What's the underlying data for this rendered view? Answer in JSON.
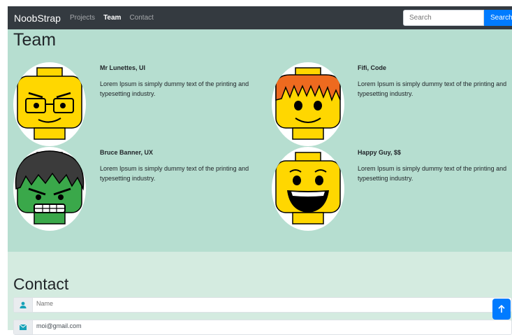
{
  "navbar": {
    "brand": "NoobStrap",
    "links": [
      {
        "label": "Projects",
        "active": false
      },
      {
        "label": "Team",
        "active": true
      },
      {
        "label": "Contact",
        "active": false
      }
    ],
    "search_placeholder": "Search",
    "search_button": "Search"
  },
  "team": {
    "title": "Team",
    "members": [
      {
        "name": "Mr Lunettes, UI",
        "desc": "Lorem Ipsum is simply dummy text of the printing and typesetting industry.",
        "avatar": "glasses-face-icon"
      },
      {
        "name": "Fifi, Code",
        "desc": "Lorem Ipsum is simply dummy text of the printing and typesetting industry.",
        "avatar": "orange-hair-face-icon"
      },
      {
        "name": "Bruce Banner, UX",
        "desc": "Lorem Ipsum is simply dummy text of the printing and typesetting industry.",
        "avatar": "hulk-face-icon"
      },
      {
        "name": "Happy Guy, $$",
        "desc": "Lorem Ipsum is simply dummy text of the printing and typesetting industry.",
        "avatar": "happy-face-icon"
      }
    ]
  },
  "contact": {
    "title": "Contact",
    "name_placeholder": "Name",
    "email_value": "moi@gmail.com"
  },
  "icons": {
    "user": "user-icon",
    "email": "envelope-icon",
    "back_to_top": "arrow-up-icon"
  },
  "colors": {
    "navbar": "#343a40",
    "accent": "#007bff",
    "team_bg": "#b6ded0",
    "contact_bg": "#d4ebe0",
    "lego_yellow": "#ffd700"
  }
}
